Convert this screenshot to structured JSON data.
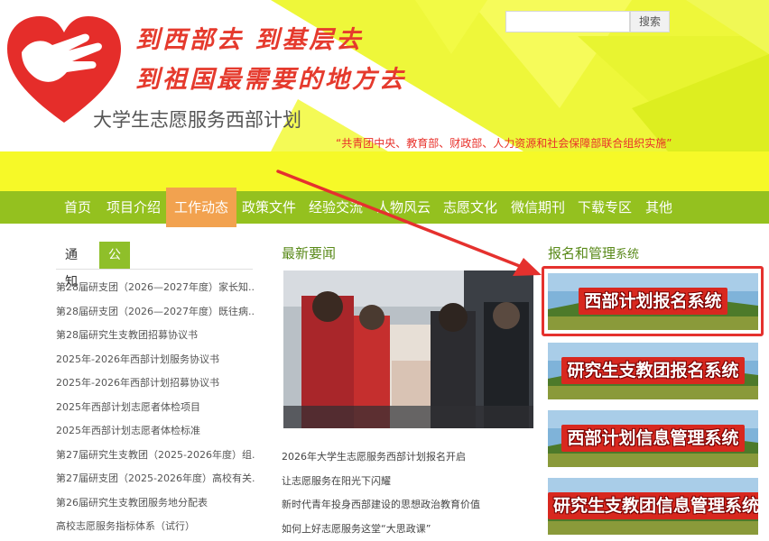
{
  "header": {
    "slogan_line1": "到西部去 到基层去",
    "slogan_line2": "到祖国最需要的地方去",
    "site_title": "大学生志愿服务西部计划",
    "orgs": "“共青团中央、教育部、财政部、人力资源和社会保障部联合组织实施”",
    "search_placeholder": "",
    "search_button": "搜索"
  },
  "nav": {
    "items": [
      {
        "label": "首页"
      },
      {
        "label": "项目介绍"
      },
      {
        "label": "工作动态"
      },
      {
        "label": "政策文件"
      },
      {
        "label": "经验交流"
      },
      {
        "label": "人物风云"
      },
      {
        "label": "志愿文化"
      },
      {
        "label": "微信期刊"
      },
      {
        "label": "下载专区"
      },
      {
        "label": "其他"
      }
    ],
    "active_index": 2
  },
  "notice": {
    "tabs": [
      "通知",
      "公告"
    ],
    "active_tab": 1,
    "items": [
      "第28届研支团（2026—2027年度）家长知...",
      "第28届研支团（2026—2027年度）既往病...",
      "第28届研究生支教团招募协议书",
      "2025年-2026年西部计划服务协议书",
      "2025年-2026年西部计划招募协议书",
      "2025年西部计划志愿者体检项目",
      "2025年西部计划志愿者体检标准",
      "第27届研究生支教团（2025-2026年度）组...",
      "第27届研支团（2025-2026年度）高校有关...",
      "第26届研究生支教团服务地分配表",
      "高校志愿服务指标体系（试行）"
    ]
  },
  "news": {
    "title": "最新要闻",
    "items": [
      "2026年大学生志愿服务西部计划报名开启",
      "让志愿服务在阳光下闪耀",
      "新时代青年投身西部建设的思想政治教育价值",
      "如何上好志愿服务这堂“大思政课”"
    ]
  },
  "systems": {
    "title_main": "报名和管理",
    "title_tail": "系统",
    "banners": [
      "西部计划报名系统",
      "研究生支教团报名系统",
      "西部计划信息管理系统",
      "研究生支教团信息管理系统"
    ]
  },
  "colors": {
    "nav_green": "#94c11f",
    "nav_active": "#f2a24f",
    "band_yellow": "#f6f928",
    "accent_red": "#e5312e"
  }
}
